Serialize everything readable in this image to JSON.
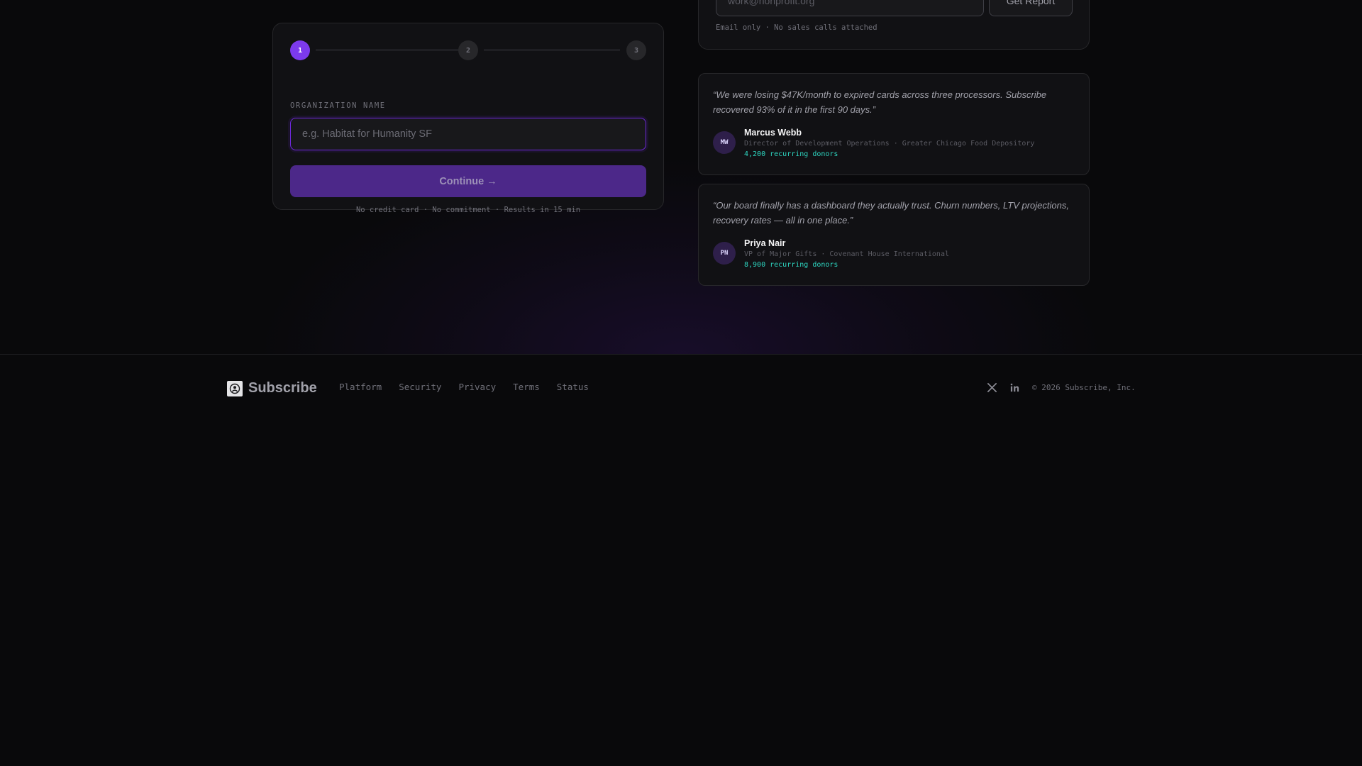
{
  "wizard": {
    "steps": [
      {
        "number": "1",
        "state": "active"
      },
      {
        "number": "2",
        "state": "upcoming"
      },
      {
        "number": "3",
        "state": "upcoming"
      }
    ],
    "field_label": "ORGANIZATION NAME",
    "field_value": "",
    "field_placeholder": "e.g. Habitat for Humanity SF",
    "continue_label": "Continue →",
    "note": "No credit card · No commitment · Results in 15 min"
  },
  "report": {
    "email_value": "",
    "email_placeholder": "work@nonprofit.org",
    "button_label": "Get Report",
    "note": "Email only · No sales calls attached"
  },
  "testimonials": [
    {
      "quote": "“We were losing $47K/month to expired cards across three processors. Subscribe recovered 93% of it in the first 90 days.”",
      "initials": "MW",
      "name": "Marcus Webb",
      "role": "Director of Development Operations · Greater Chicago Food Depository",
      "metric": "4,200 recurring donors"
    },
    {
      "quote": "“Our board finally has a dashboard they actually trust. Churn numbers, LTV projections, recovery rates — all in one place.”",
      "initials": "PN",
      "name": "Priya Nair",
      "role": "VP of Major Gifts · Covenant House International",
      "metric": "8,900 recurring donors"
    }
  ],
  "footer": {
    "brand": "Subscribe",
    "links": [
      "Platform",
      "Security",
      "Privacy",
      "Terms",
      "Status"
    ],
    "social_icons": [
      "x-icon",
      "linkedin-icon"
    ],
    "copyright": "© 2026 Subscribe, Inc."
  },
  "colors": {
    "background": "#09090b",
    "card": "#111114",
    "accent": "#7c3aed",
    "button": "#4c2889",
    "metric": "#2dd4bf"
  }
}
